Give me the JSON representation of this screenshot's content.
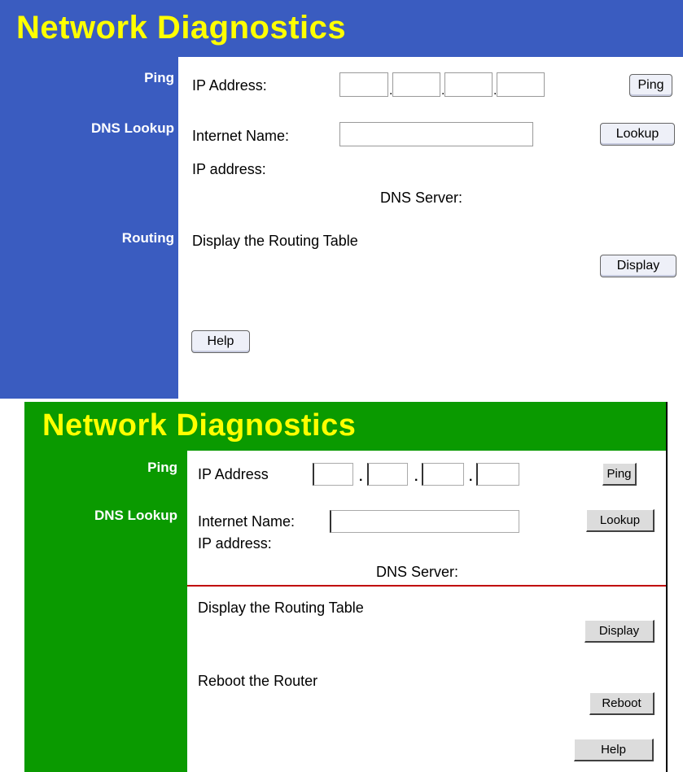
{
  "panel1": {
    "title": "Network Diagnostics",
    "sections": {
      "ping": "Ping",
      "dns_lookup": "DNS Lookup",
      "routing": "Routing"
    },
    "ping": {
      "label": "IP Address:",
      "octets": [
        "",
        "",
        "",
        ""
      ],
      "button": "Ping"
    },
    "dns": {
      "internet_name_label": "Internet Name:",
      "internet_name_value": "",
      "button": "Lookup",
      "ip_address_label": "IP address:",
      "dns_server_label": "DNS Server:"
    },
    "routing": {
      "text": "Display the Routing Table",
      "button": "Display"
    },
    "help_button": "Help",
    "colors": {
      "accent": "#3a5cc0",
      "title": "#ffff00"
    }
  },
  "panel2": {
    "title": "Network Diagnostics",
    "sections": {
      "ping": "Ping",
      "dns_lookup": "DNS Lookup"
    },
    "ping": {
      "label": "IP Address",
      "octets": [
        "",
        "",
        "",
        ""
      ],
      "button": "Ping"
    },
    "dns": {
      "internet_name_label": "Internet Name:",
      "internet_name_value": "",
      "button": "Lookup",
      "ip_address_label": "IP address:",
      "dns_server_label": "DNS Server:"
    },
    "routing": {
      "text": "Display the Routing Table",
      "button": "Display"
    },
    "reboot": {
      "text": "Reboot the Router",
      "button": "Reboot"
    },
    "help_button": "Help",
    "colors": {
      "accent": "#0a9a00",
      "title": "#ffff00",
      "divider": "#c00000"
    }
  }
}
